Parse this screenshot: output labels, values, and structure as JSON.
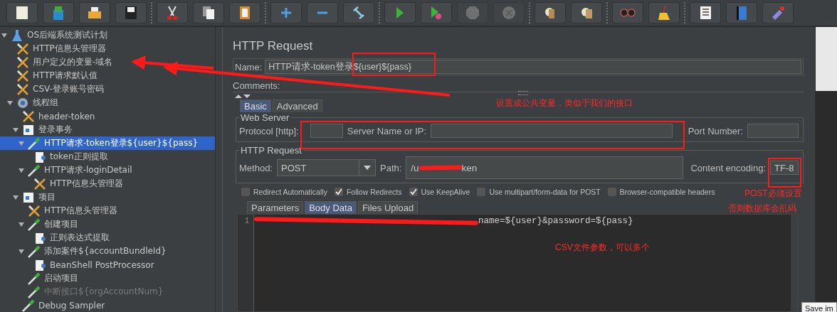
{
  "toolbar_groups": [
    {
      "buttons": [
        {
          "kind": "new",
          "disabled": false
        },
        {
          "kind": "templates",
          "disabled": false
        },
        {
          "kind": "open",
          "disabled": false
        },
        {
          "kind": "save",
          "disabled": false
        }
      ]
    },
    {
      "buttons": [
        {
          "kind": "cut",
          "disabled": false
        },
        {
          "kind": "copy",
          "disabled": false
        },
        {
          "kind": "paste",
          "disabled": false
        }
      ]
    },
    {
      "buttons": [
        {
          "kind": "expand",
          "disabled": false
        },
        {
          "kind": "collapse",
          "disabled": false
        },
        {
          "kind": "toggle",
          "disabled": false
        }
      ]
    },
    {
      "buttons": [
        {
          "kind": "start",
          "disabled": false
        },
        {
          "kind": "start-no-pause",
          "disabled": false
        },
        {
          "kind": "stop",
          "disabled": true
        },
        {
          "kind": "shutdown",
          "disabled": true
        }
      ]
    },
    {
      "buttons": [
        {
          "kind": "clear",
          "disabled": false
        },
        {
          "kind": "clear-all",
          "disabled": false
        }
      ]
    },
    {
      "buttons": [
        {
          "kind": "search",
          "disabled": false
        },
        {
          "kind": "reset",
          "disabled": false
        }
      ]
    },
    {
      "buttons": [
        {
          "kind": "function",
          "disabled": false
        },
        {
          "kind": "help",
          "disabled": false
        },
        {
          "kind": "remote",
          "disabled": false
        }
      ]
    }
  ],
  "tree": [
    {
      "label": "OS后端系统测试计划",
      "kind": "plan",
      "expanded": true,
      "selected": false,
      "disabled": false,
      "children": [
        {
          "label": "HTTP信息头管理器",
          "kind": "config",
          "selected": false,
          "disabled": false
        },
        {
          "label": "用户定义的变量-域名",
          "kind": "config",
          "selected": false,
          "disabled": false
        },
        {
          "label": "HTTP请求默认值",
          "kind": "config",
          "selected": false,
          "disabled": false
        },
        {
          "label": "CSV-登录账号密码",
          "kind": "config",
          "selected": false,
          "disabled": false
        },
        {
          "label": "线程组",
          "kind": "threadgroup",
          "expanded": true,
          "selected": false,
          "disabled": false,
          "children": [
            {
              "label": "header-token",
              "kind": "config",
              "selected": false,
              "disabled": false
            },
            {
              "label": "登录事务",
              "kind": "controller",
              "expanded": true,
              "selected": false,
              "disabled": false,
              "children": [
                {
                  "label": "HTTP请求-token登录${user}${pass}",
                  "kind": "sampler",
                  "expanded": true,
                  "selected": true,
                  "disabled": false,
                  "children": [
                    {
                      "label": "token正则提取",
                      "kind": "postprocessor",
                      "selected": false,
                      "disabled": false
                    }
                  ]
                },
                {
                  "label": "HTTP请求-loginDetail",
                  "kind": "sampler",
                  "expanded": true,
                  "selected": false,
                  "disabled": false,
                  "children": [
                    {
                      "label": "HTTP信息头管理器",
                      "kind": "config",
                      "selected": false,
                      "disabled": false
                    }
                  ]
                }
              ]
            },
            {
              "label": "项目",
              "kind": "controller",
              "expanded": true,
              "selected": false,
              "disabled": false,
              "children": [
                {
                  "label": "HTTP信息头管理器",
                  "kind": "config",
                  "selected": false,
                  "disabled": false
                },
                {
                  "label": "创建项目",
                  "kind": "sampler",
                  "expanded": true,
                  "selected": false,
                  "disabled": false,
                  "children": [
                    {
                      "label": "正则表达式提取",
                      "kind": "postprocessor",
                      "selected": false,
                      "disabled": false
                    }
                  ]
                },
                {
                  "label": "添加案件${accountBundleId}",
                  "kind": "sampler",
                  "expanded": true,
                  "selected": false,
                  "disabled": false,
                  "children": [
                    {
                      "label": "BeanShell PostProcessor",
                      "kind": "postprocessor",
                      "selected": false,
                      "disabled": false
                    }
                  ]
                },
                {
                  "label": "启动项目",
                  "kind": "sampler",
                  "selected": false,
                  "disabled": false
                },
                {
                  "label": "中断接口${orgAccountNum}",
                  "kind": "sampler",
                  "selected": false,
                  "disabled": true
                }
              ]
            },
            {
              "label": "Debug Sampler",
              "kind": "sampler",
              "selected": false,
              "disabled": false
            }
          ]
        }
      ]
    }
  ],
  "panel": {
    "title": "HTTP Request",
    "name_label": "Name:",
    "name_value": "HTTP请求-token登录${user}${pass}",
    "comments_label": "Comments:",
    "tabs": [
      {
        "label": "Basic",
        "selected": true
      },
      {
        "label": "Advanced",
        "selected": false
      }
    ],
    "web_server": {
      "legend": "Web Server",
      "protocol_label": "Protocol [http]:",
      "server_label": "Server Name or IP:",
      "port_label": "Port Number:"
    },
    "http_request": {
      "legend": "HTTP Request",
      "method_label": "Method:",
      "method_value": "POST",
      "path_label": "Path:",
      "path_visible_parts": [
        "/u",
        "ken"
      ],
      "encoding_label": "Content encoding:",
      "encoding_value": "TF-8",
      "options": [
        {
          "label": "Redirect Automatically",
          "checked": false
        },
        {
          "label": "Follow Redirects",
          "checked": true
        },
        {
          "label": "Use KeepAlive",
          "checked": true
        },
        {
          "label": "Use multipart/form-data for POST",
          "checked": false
        },
        {
          "label": "Browser-compatible headers",
          "checked": false
        }
      ]
    },
    "body_tabs": [
      {
        "label": "Parameters",
        "selected": false
      },
      {
        "label": "Body Data",
        "selected": true
      },
      {
        "label": "Files Upload",
        "selected": false
      }
    ],
    "body_lines": [
      {
        "number": "1",
        "visible_text": "name=${user}&password=${pass}"
      }
    ]
  },
  "annotations": [
    {
      "text": "设置成公共变量，类似于我们的接口"
    },
    {
      "text": "POST必须设置"
    },
    {
      "text": "否则数据库会乱码"
    },
    {
      "text": "CSV文件参数，可以多个"
    }
  ],
  "tooltip": {
    "text": "Save im"
  }
}
